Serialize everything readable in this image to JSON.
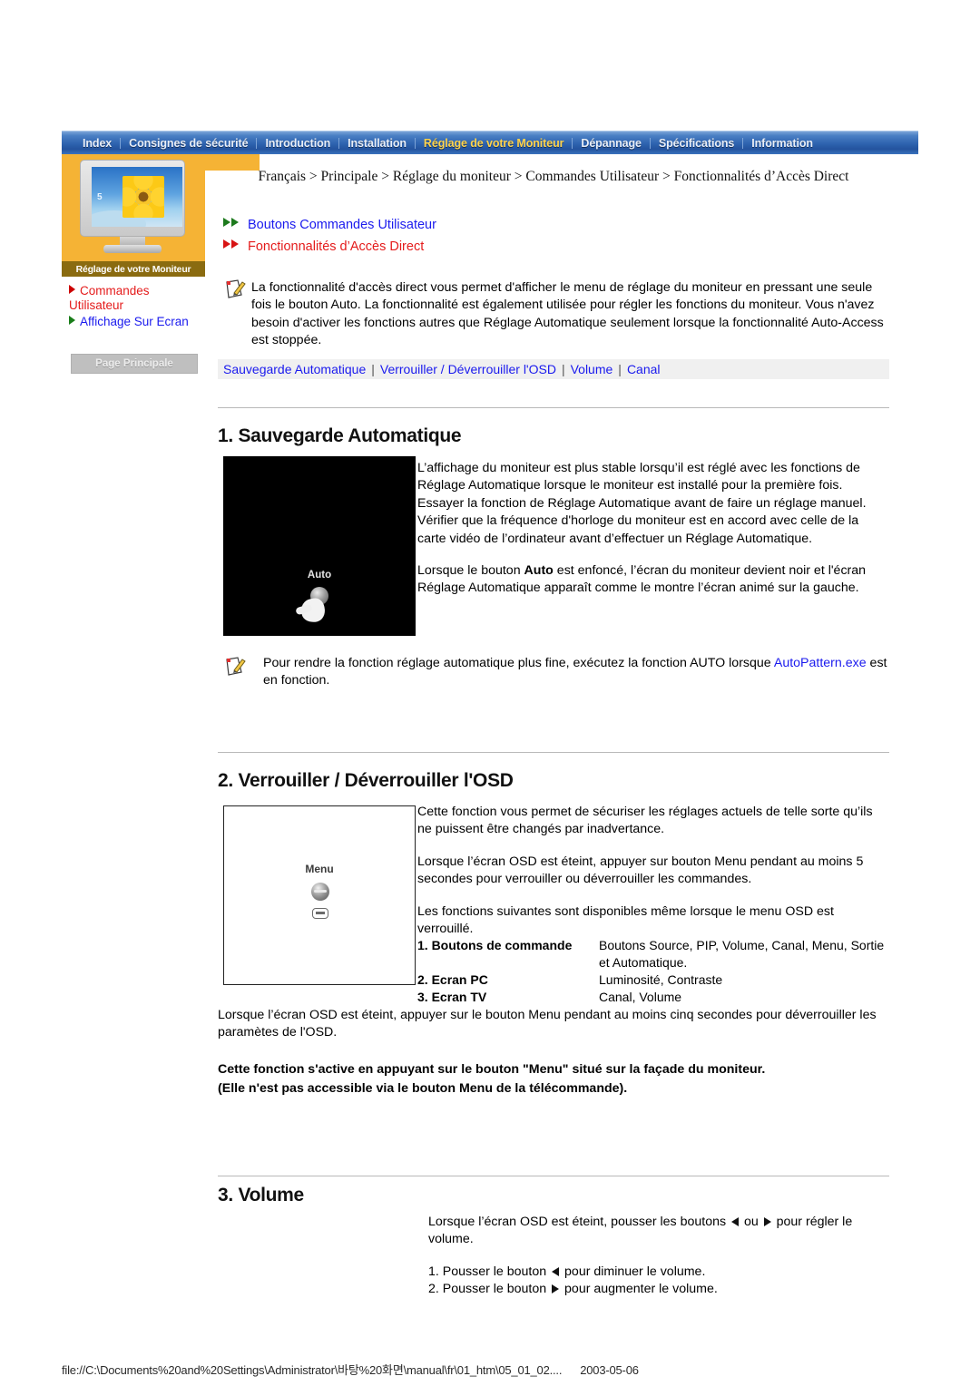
{
  "nav": {
    "items": [
      {
        "label": "Index",
        "active": false
      },
      {
        "label": "Consignes de sécurité",
        "active": false
      },
      {
        "label": "Introduction",
        "active": false
      },
      {
        "label": "Installation",
        "active": false
      },
      {
        "label": "Réglage de votre Moniteur",
        "active": true
      },
      {
        "label": "Dépannage",
        "active": false
      },
      {
        "label": "Spécifications",
        "active": false
      },
      {
        "label": "Information",
        "active": false
      }
    ]
  },
  "sidebar": {
    "caption": "Réglage de votre Moniteur",
    "screen_digit": "5",
    "links": [
      {
        "label": "Commandes Utilisateur",
        "color": "#e41b1b",
        "bullet": "#cc0000"
      },
      {
        "label": "Affichage Sur Ecran",
        "color": "#1a1aee",
        "bullet": "#197d19"
      }
    ],
    "home_button": "Page Principale"
  },
  "breadcrumb": "Français > Principale > Réglage du moniteur > Commandes Utilisateur > Fonctionnalités d’Accès Direct",
  "anchors": [
    {
      "label": "Boutons Commandes Utilisateur",
      "arrow_color": "#1d7a1d",
      "text_color": "#1a1aee"
    },
    {
      "label": "Fonctionnalités d’Accès Direct",
      "arrow_color": "#d81414",
      "text_color": "#e41b1b"
    }
  ],
  "intro": "La fonctionnalité d'accès direct vous permet d'afficher le menu de réglage du moniteur en pressant une seule fois le bouton Auto. La fonctionnalité est également utilisée pour régler les fonctions du moniteur. Vous n'avez besoin d'activer les fonctions autres que Réglage Automatique seulement lorsque la fonctionnalité Auto-Access est stoppée.",
  "subnav": {
    "links": [
      "Sauvegarde Automatique",
      "Verrouiller / Déverrouiller l'OSD",
      "Volume",
      "Canal"
    ],
    "separator": "|"
  },
  "section1": {
    "heading": "1. Sauvegarde Automatique",
    "figure_caption": "Auto",
    "para1": "L’affichage du moniteur est plus stable lorsqu’il est réglé avec les fonctions de Réglage Automatique lorsque le moniteur est installé pour la première fois. Essayer la fonction de Réglage Automatique avant de faire un réglage manuel. Vérifier que la fréquence d'horloge du moniteur est en accord avec celle de la carte vidéo de l’ordinateur avant d’effectuer un Réglage Automatique.",
    "para2_a": "Lorsque le bouton ",
    "para2_b": "Auto",
    "para2_c": " est enfoncé, l’écran du moniteur devient noir et l'écran Réglage Automatique apparaît comme le montre l’écran animé sur la gauche.",
    "note_a": "Pour rendre la fonction réglage automatique plus fine, exécutez la fonction AUTO lorsque ",
    "note_link": "AutoPattern.exe",
    "note_b": " est en fonction."
  },
  "section2": {
    "heading": "2. Verrouiller / Déverrouiller l'OSD",
    "figure_caption": "Menu",
    "para1": "Cette fonction vous permet de sécuriser les réglages actuels de telle sorte qu’ils ne puissent être changés par inadvertance.",
    "para2": "Lorsque l’écran OSD est éteint, appuyer sur bouton Menu pendant au moins 5 secondes pour verrouiller ou déverrouiller les commandes.",
    "para3": "Les fonctions suivantes sont disponibles même lorsque le menu OSD est verrouillé.",
    "table": [
      {
        "key": "1. Boutons de commande",
        "value": "Boutons Source, PIP, Volume, Canal, Menu, Sortie et Automatique."
      },
      {
        "key": "2. Ecran PC",
        "value": "Luminosité, Contraste"
      },
      {
        "key": "3. Ecran TV",
        "value": "Canal, Volume"
      }
    ],
    "para4": "Lorsque l’écran OSD est éteint, appuyer sur le bouton Menu pendant au moins cinq secondes pour déverrouiller les paramètes de l'OSD.",
    "bold1": "Cette fonction s'active en appuyant sur le bouton \"Menu\" situé sur la façade du moniteur.",
    "bold2": "(Elle n'est pas accessible via le bouton Menu de la télécommande)."
  },
  "section3": {
    "heading": "3. Volume",
    "para1_a": "Lorsque l’écran OSD est éteint, pousser les boutons ",
    "para1_b": " ou ",
    "para1_c": " pour régler le volume.",
    "item1_a": "1. Pousser le bouton ",
    "item1_b": " pour diminuer le volume.",
    "item2_a": "2. Pousser le bouton ",
    "item2_b": " pour augmenter le volume."
  },
  "footer": {
    "path": "file://C:\\Documents%20and%20Settings\\Administrator\\바탕%20화면\\manual\\fr\\01_htm\\05_01_02....",
    "date": "2003-05-06"
  }
}
